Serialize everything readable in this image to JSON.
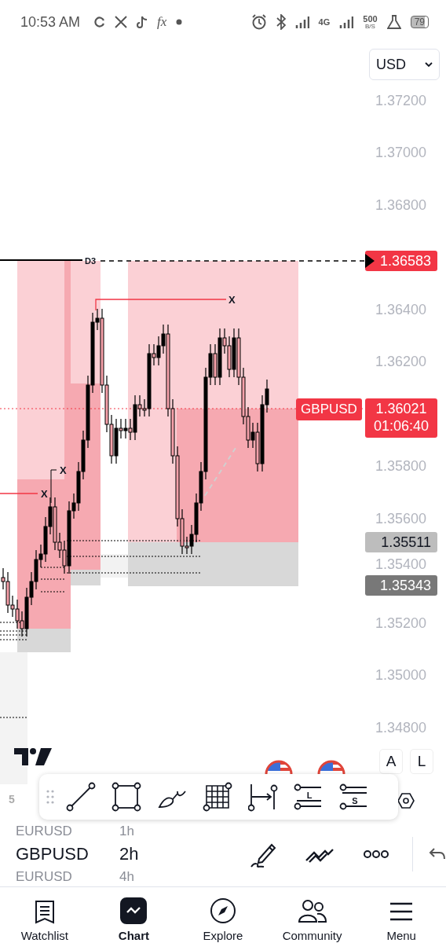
{
  "status_bar": {
    "time": "10:53 AM",
    "fx": "fx",
    "network": "4G",
    "speed": "500",
    "speed_unit": "B/S",
    "battery": "79"
  },
  "currency_select": {
    "value": "USD"
  },
  "price_axis": {
    "ticks": [
      "1.37200",
      "1.37000",
      "1.36800",
      "1.36400",
      "1.36200",
      "1.35800",
      "1.35600",
      "1.35400",
      "1.35200",
      "1.35000",
      "1.34800"
    ]
  },
  "price_tags": [
    {
      "kind": "alert",
      "price": "1.36583"
    },
    {
      "kind": "high",
      "price": "1.35511"
    },
    {
      "kind": "low",
      "price": "1.35343"
    }
  ],
  "last_price": {
    "symbol": "GBPUSD",
    "price": "1.36021",
    "countdown": "01:06:40"
  },
  "chart_marks": [
    {
      "kind": "level",
      "text": "D3"
    },
    {
      "kind": "sweep",
      "text": "X"
    },
    {
      "kind": "sweep",
      "text": "X"
    },
    {
      "kind": "sweep",
      "text": "X"
    }
  ],
  "chart_controls": {
    "auto": "A",
    "log": "L"
  },
  "hidden_value": "5",
  "drawing_toolbar": [
    {
      "kind": "line"
    },
    {
      "kind": "rectangle"
    },
    {
      "kind": "brush"
    },
    {
      "kind": "grid"
    },
    {
      "kind": "measure"
    },
    {
      "kind": "long",
      "letter": "L"
    },
    {
      "kind": "short",
      "letter": "S"
    }
  ],
  "symbols": [
    {
      "symbol": "EURUSD",
      "interval": "1h",
      "selected": false
    },
    {
      "symbol": "GBPUSD",
      "interval": "2h",
      "selected": true
    },
    {
      "symbol": "EURUSD",
      "interval": "4h",
      "selected": false
    }
  ],
  "nav": [
    {
      "kind": "watchlist",
      "label": "Watchlist",
      "selected": false
    },
    {
      "kind": "chart",
      "label": "Chart",
      "selected": true
    },
    {
      "kind": "explore",
      "label": "Explore",
      "selected": false
    },
    {
      "kind": "community",
      "label": "Community",
      "selected": false
    },
    {
      "kind": "menu",
      "label": "Menu",
      "selected": false
    }
  ]
}
